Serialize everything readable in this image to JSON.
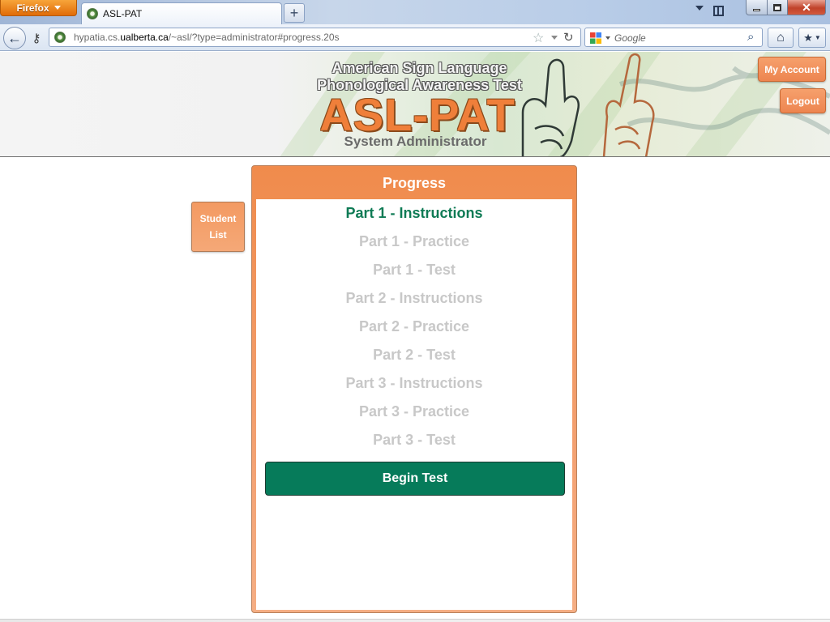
{
  "browser": {
    "menu_label": "Firefox",
    "tab_title": "ASL-PAT",
    "new_tab_label": "+",
    "url_prefix": "hypatia.cs.",
    "url_domain": "ualberta.ca",
    "url_suffix": "/~asl/?type=administrator#progress.20s",
    "search_placeholder": "Google",
    "close_glyph": "✕"
  },
  "header": {
    "subtitle_line1": "American Sign Language",
    "subtitle_line2": "Phonological Awareness Test",
    "logo": "ASL-PAT",
    "role": "System Administrator",
    "my_account_label": "My Account",
    "logout_label": "Logout"
  },
  "sidebar": {
    "student_list_line1": "Student",
    "student_list_line2": "List"
  },
  "progress": {
    "title": "Progress",
    "steps": [
      "Part 1 - Instructions",
      "Part 1 - Practice",
      "Part 1 - Test",
      "Part 2 - Instructions",
      "Part 2 - Practice",
      "Part 2 - Test",
      "Part 3 - Instructions",
      "Part 3 - Practice",
      "Part 3 - Test"
    ],
    "begin_label": "Begin Test"
  },
  "colors": {
    "accent_orange": "#ef7f3a",
    "active_step": "#0f7b55",
    "inactive_step": "#c8c8c8",
    "begin_button": "#067b5a"
  }
}
